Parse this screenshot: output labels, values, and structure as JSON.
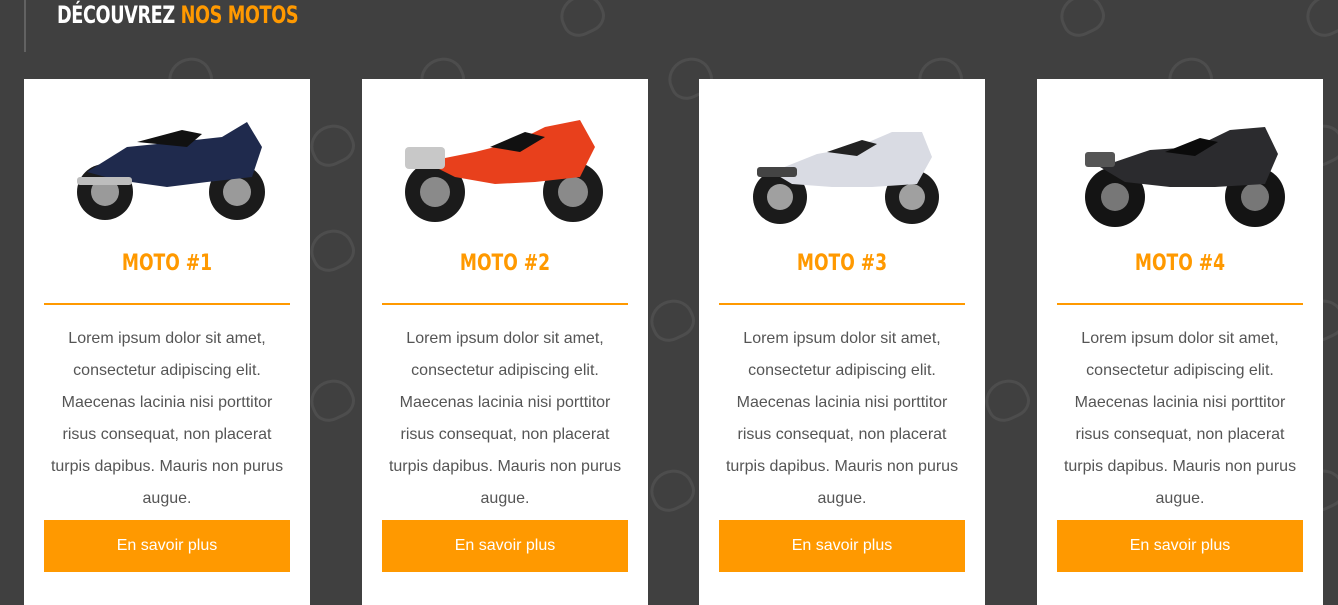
{
  "section": {
    "title_part1": "DÉCOUVREZ",
    "title_part2": "NOS MOTOS"
  },
  "colors": {
    "background": "#404040",
    "accent": "#ff9900",
    "card": "#ffffff",
    "text": "#555555"
  },
  "cards": [
    {
      "title": "MOTO #1",
      "image": "motorcycle-navy-sport",
      "description": "Lorem ipsum dolor sit amet, consectetur adipiscing elit. Maecenas lacinia nisi porttitor risus consequat, non placerat turpis dapibus. Mauris non purus augue.",
      "button_label": "En savoir plus"
    },
    {
      "title": "MOTO #2",
      "image": "motorcycle-red-sport",
      "description": "Lorem ipsum dolor sit amet, consectetur adipiscing elit. Maecenas lacinia nisi porttitor risus consequat, non placerat turpis dapibus. Mauris non purus augue.",
      "button_label": "En savoir plus"
    },
    {
      "title": "MOTO #3",
      "image": "motorcycle-silver-sport",
      "description": "Lorem ipsum dolor sit amet, consectetur adipiscing elit. Maecenas lacinia nisi porttitor risus consequat, non placerat turpis dapibus. Mauris non purus augue.",
      "button_label": "En savoir plus"
    },
    {
      "title": "MOTO #4",
      "image": "motorcycle-black-sport",
      "description": "Lorem ipsum dolor sit amet, consectetur adipiscing elit. Maecenas lacinia nisi porttitor risus consequat, non placerat turpis dapibus. Mauris non purus augue.",
      "button_label": "En savoir plus"
    }
  ]
}
